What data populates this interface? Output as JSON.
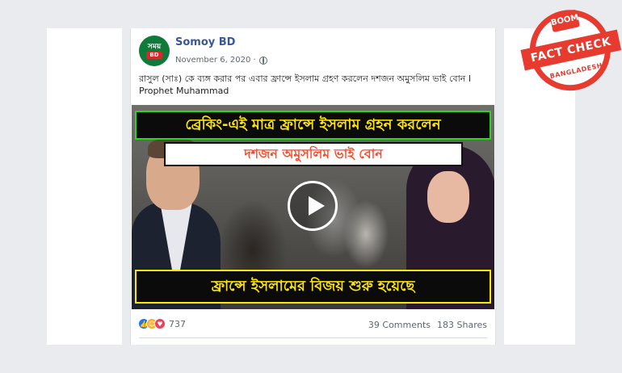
{
  "post": {
    "avatar_top": "সময়",
    "avatar_bottom": "BD",
    "page_name": "Somoy BD",
    "date": "November 6, 2020 ·",
    "privacy_icon": "globe-icon",
    "text": "রাসুল (সাঃ) কে ব্যঙ্গ করার পর এবার ফ্রান্সে ইসলাম গ্রহণ করলেন দশজন অমুসলিম ভাই বোন l Prophet Muhammad"
  },
  "video": {
    "headline_top": "ব্রেকিং-এই মাত্র ফ্রান্সে ইসলাম গ্রহন করলেন",
    "headline_mid": "দশজন অমুসলিম ভাই বোন",
    "headline_bottom": "ফ্রান্সে ইসলামের বিজয় শুরু হয়েছে",
    "play_icon": "play-icon"
  },
  "footer": {
    "reaction_icons": [
      "like-icon",
      "haha-icon",
      "love-icon"
    ],
    "reaction_count": "737",
    "comments": "39 Comments",
    "shares": "183 Shares"
  },
  "watermark": {
    "brand": "BOOM",
    "label": "FACT CHECK",
    "region": "BANGLADESH",
    "color": "#e63b2e"
  }
}
